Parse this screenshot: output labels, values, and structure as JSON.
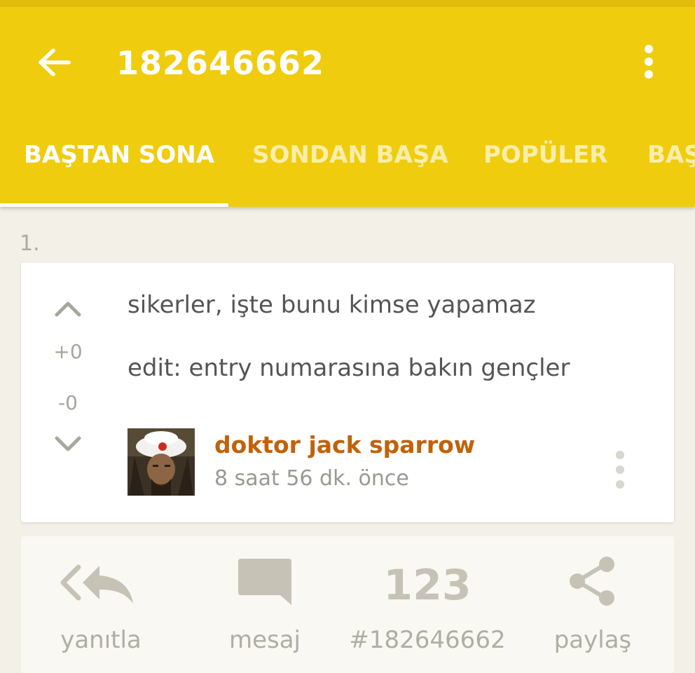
{
  "header": {
    "title": "182646662",
    "back_icon": "arrow-back-icon",
    "menu_icon": "more-vertical-icon",
    "background": "#f0cc0e"
  },
  "tabs": [
    {
      "label": "BAŞTAN SONA",
      "active": true
    },
    {
      "label": "SONDAN BAŞA",
      "active": false
    },
    {
      "label": "POPÜLER",
      "active": false
    },
    {
      "label": "BAŞ",
      "active": false
    }
  ],
  "entry": {
    "index": "1.",
    "upvotes": "+0",
    "downvotes": "-0",
    "lines": [
      "sikerler, işte bunu kimse yapamaz",
      "edit: entry numarasına bakın gençler"
    ],
    "author": "doktor jack sparrow",
    "time": "8 saat 56 dk. önce",
    "author_color": "#c0620b"
  },
  "actions": [
    {
      "label": "yanıtla",
      "icon": "reply-all-icon"
    },
    {
      "label": "mesaj",
      "icon": "message-icon"
    },
    {
      "label": "#182646662",
      "icon": "numbers-123-icon"
    },
    {
      "label": "paylaş",
      "icon": "share-icon"
    }
  ]
}
